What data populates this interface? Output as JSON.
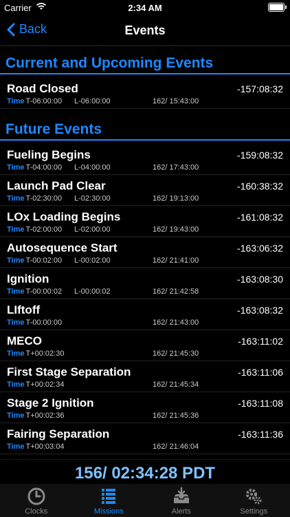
{
  "status_bar": {
    "carrier": "Carrier",
    "time": "2:34 AM"
  },
  "nav": {
    "back_label": "Back",
    "title": "Events"
  },
  "sections": {
    "current": {
      "title": "Current and Upcoming Events",
      "events": [
        {
          "name": "Road Closed",
          "countdown": "-157:08:32",
          "time_label": "Time",
          "t_time": "T-06:00:00",
          "l_time": "L-06:00:00",
          "datetime": "162/ 15:43:00"
        }
      ]
    },
    "future": {
      "title": "Future Events",
      "events": [
        {
          "name": "Fueling Begins",
          "countdown": "-159:08:32",
          "time_label": "Time",
          "t_time": "T-04:00:00",
          "l_time": "L-04:00:00",
          "datetime": "162/ 17:43:00"
        },
        {
          "name": "Launch Pad Clear",
          "countdown": "-160:38:32",
          "time_label": "Time",
          "t_time": "T-02:30:00",
          "l_time": "L-02:30:00",
          "datetime": "162/ 19:13:00"
        },
        {
          "name": "LOx Loading Begins",
          "countdown": "-161:08:32",
          "time_label": "Time",
          "t_time": "T-02:00:00",
          "l_time": "L-02:00:00",
          "datetime": "162/ 19:43:00"
        },
        {
          "name": "Autosequence Start",
          "countdown": "-163:06:32",
          "time_label": "Time",
          "t_time": "T-00:02:00",
          "l_time": "L-00:02:00",
          "datetime": "162/ 21:41:00"
        },
        {
          "name": "Ignition",
          "countdown": "-163:08:30",
          "time_label": "Time",
          "t_time": "T-00:00:02",
          "l_time": "L-00:00:02",
          "datetime": "162/ 21:42:58"
        },
        {
          "name": "LIftoff",
          "countdown": "-163:08:32",
          "time_label": "Time",
          "t_time": "T-00:00:00",
          "l_time": "",
          "datetime": "162/ 21:43:00"
        },
        {
          "name": "MECO",
          "countdown": "-163:11:02",
          "time_label": "Time",
          "t_time": "T+00:02:30",
          "l_time": "",
          "datetime": "162/ 21:45:30"
        },
        {
          "name": "First Stage Separation",
          "countdown": "-163:11:06",
          "time_label": "Time",
          "t_time": "T+00:02:34",
          "l_time": "",
          "datetime": "162/ 21:45:34"
        },
        {
          "name": "Stage 2 Ignition",
          "countdown": "-163:11:08",
          "time_label": "Time",
          "t_time": "T+00:02:36",
          "l_time": "",
          "datetime": "162/ 21:45:36"
        },
        {
          "name": "Fairing Separation",
          "countdown": "-163:11:36",
          "time_label": "Time",
          "t_time": "T+00:03:04",
          "l_time": "",
          "datetime": "162/ 21:46:04"
        }
      ]
    }
  },
  "clock": {
    "display": "156/ 02:34:28 PDT"
  },
  "tabbar": {
    "tabs": [
      {
        "label": "Clocks",
        "icon": "clock-icon",
        "active": false
      },
      {
        "label": "Missions",
        "icon": "list-icon",
        "active": true
      },
      {
        "label": "Alerts",
        "icon": "inbox-icon",
        "active": false
      },
      {
        "label": "Settings",
        "icon": "gear-icon",
        "active": false
      }
    ]
  },
  "colors": {
    "accent": "#1e88ff",
    "clock": "#7ec2ff",
    "background": "#000000"
  }
}
